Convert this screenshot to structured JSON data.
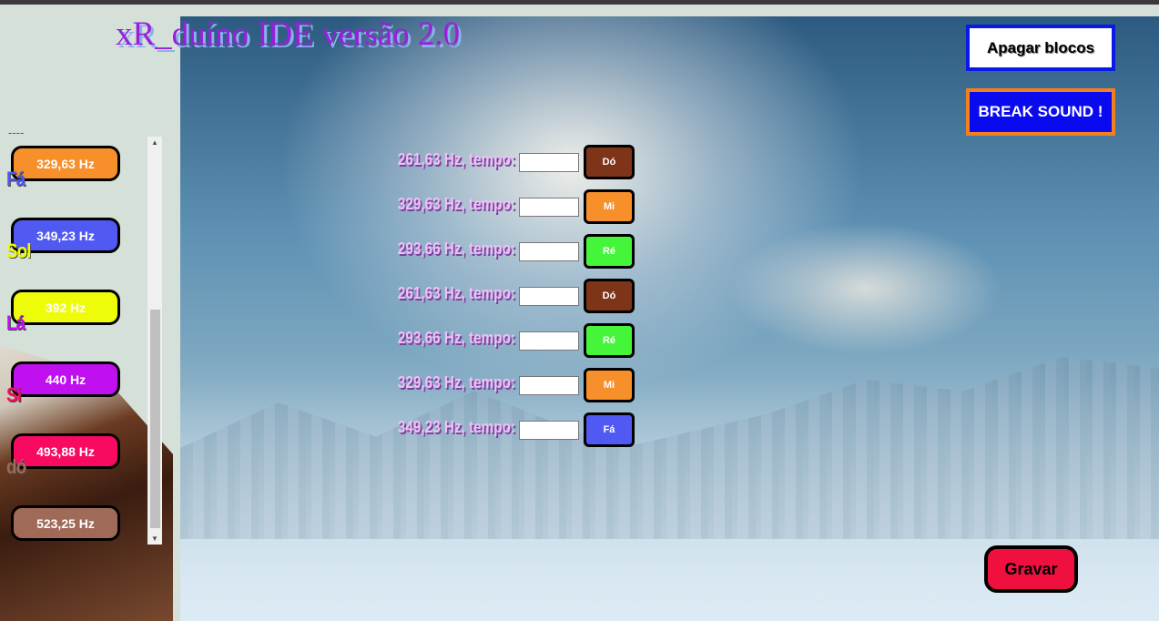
{
  "title": "xR_duíno IDE versão 2.0",
  "buttons": {
    "clear": "Apagar blocos",
    "break_sound": "BREAK SOUND !",
    "record": "Gravar"
  },
  "sidebar": {
    "separator": "----",
    "notes": [
      {
        "label": "",
        "freq": "329,63 Hz",
        "color": "#f78f2a",
        "label_color": ""
      },
      {
        "label": "Fá",
        "freq": "349,23 Hz",
        "color": "#5059f2",
        "label_color": "#5059f2"
      },
      {
        "label": "Sol",
        "freq": "392 Hz",
        "color": "#eefc0a",
        "label_color": "#eefc0a"
      },
      {
        "label": "Lá",
        "freq": "440 Hz",
        "color": "#c010f0",
        "label_color": "#c010f0"
      },
      {
        "label": "Si",
        "freq": "493,88 Hz",
        "color": "#f80a60",
        "label_color": "#f80a60"
      },
      {
        "label": "dó",
        "freq": "523,25 Hz",
        "color": "#a06a58",
        "label_color": "#a06a58"
      }
    ]
  },
  "blocks": [
    {
      "text": "261,63 Hz, tempo:",
      "value": "",
      "note": "Dó",
      "color": "#7e3418"
    },
    {
      "text": "329,63 Hz, tempo:",
      "value": "",
      "note": "Mi",
      "color": "#f78f2a"
    },
    {
      "text": "293,66 Hz, tempo:",
      "value": "",
      "note": "Ré",
      "color": "#45f53a"
    },
    {
      "text": "261,63 Hz, tempo:",
      "value": "",
      "note": "Dó",
      "color": "#7e3418"
    },
    {
      "text": "293,66 Hz, tempo:",
      "value": "",
      "note": "Ré",
      "color": "#45f53a"
    },
    {
      "text": "329,63 Hz, tempo:",
      "value": "",
      "note": "Mi",
      "color": "#f78f2a"
    },
    {
      "text": "349,23 Hz, tempo:",
      "value": "",
      "note": "Fá",
      "color": "#5059f2"
    }
  ]
}
